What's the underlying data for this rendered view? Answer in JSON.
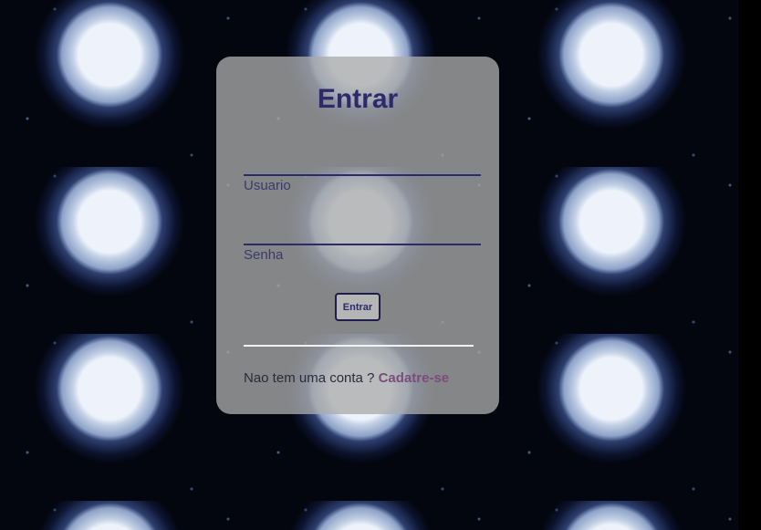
{
  "login": {
    "title": "Entrar",
    "username_label": "Usuario",
    "password_label": "Senha",
    "submit_label": "Entrar",
    "no_account_text": "Nao tem uma conta ?",
    "signup_link": "Cadatre-se"
  },
  "colors": {
    "title": "#2c2a6b",
    "link": "#7a4d7a",
    "card": "#aaaaaa",
    "background": "#03060f"
  },
  "icons": {
    "background": "moon-pattern"
  }
}
